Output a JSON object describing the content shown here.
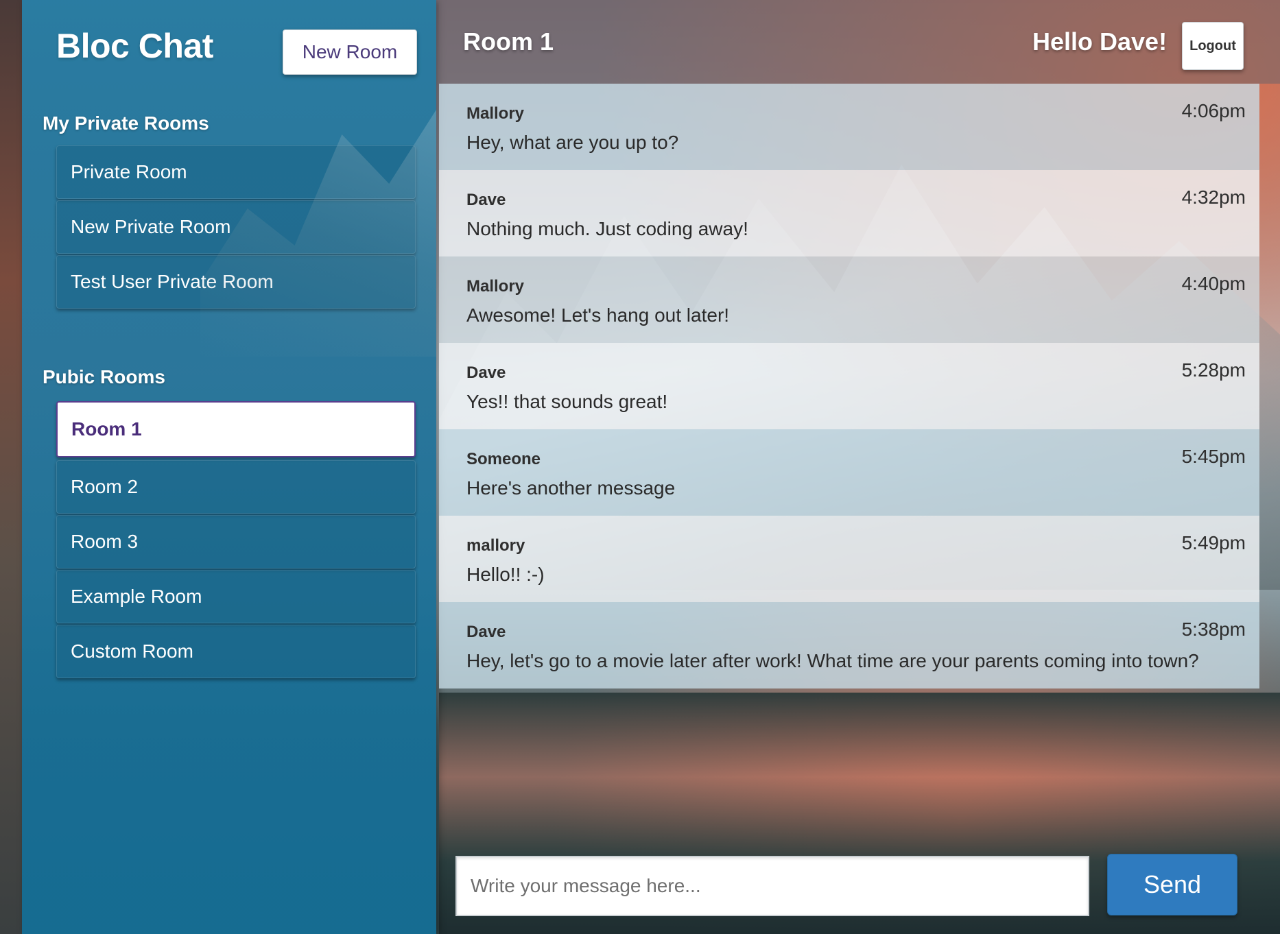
{
  "sidebar": {
    "app_title": "Bloc Chat",
    "new_room_label": "New Room",
    "private_heading": "My Private Rooms",
    "private_rooms": [
      {
        "label": "Private Room"
      },
      {
        "label": "New Private Room"
      },
      {
        "label": "Test User Private Room"
      }
    ],
    "public_heading": "Pubic Rooms",
    "public_rooms": [
      {
        "label": "Room 1",
        "active": true
      },
      {
        "label": "Room 2"
      },
      {
        "label": "Room 3"
      },
      {
        "label": "Example Room"
      },
      {
        "label": "Custom Room"
      }
    ]
  },
  "header": {
    "room_title": "Room 1",
    "greeting": "Hello Dave!",
    "logout_label": "Logout"
  },
  "messages": [
    {
      "user": "Mallory",
      "time": "4:06pm",
      "text": "Hey, what are you up to?"
    },
    {
      "user": "Dave",
      "time": "4:32pm",
      "text": "Nothing much. Just coding away!"
    },
    {
      "user": "Mallory",
      "time": "4:40pm",
      "text": "Awesome! Let's hang out later!"
    },
    {
      "user": "Dave",
      "time": "5:28pm",
      "text": "Yes!! that sounds great!"
    },
    {
      "user": "Someone",
      "time": "5:45pm",
      "text": "Here's another message"
    },
    {
      "user": "mallory",
      "time": "5:49pm",
      "text": "Hello!! :-)"
    },
    {
      "user": "Dave",
      "time": "5:38pm",
      "text": "Hey, let's go to a movie later after work! What time are your parents coming into town?"
    }
  ],
  "composer": {
    "placeholder": "Write your message here...",
    "value": "",
    "send_label": "Send"
  },
  "colors": {
    "sidebar": "#1f7ba6",
    "active_room_text": "#4a2d7a",
    "send_button": "#2f7bbf"
  }
}
